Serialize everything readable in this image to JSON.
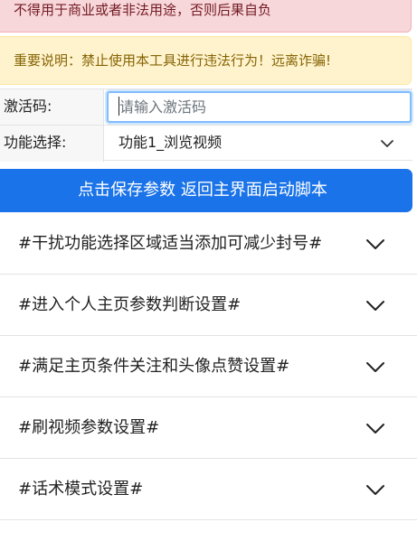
{
  "alerts": {
    "danger_text": "不得用于商业或者非法用途，否则后果自负",
    "warning_text": "重要说明：禁止使用本工具进行违法行为！远离诈骗!"
  },
  "form": {
    "activation": {
      "label": "激活码:",
      "placeholder": "请输入激活码",
      "value": ""
    },
    "function_select": {
      "label": "功能选择:",
      "selected": "功能1_浏览视频"
    }
  },
  "save_button": {
    "label": "点击保存参数 返回主界面启动脚本",
    "color": "#1a73e8"
  },
  "floating_icon": {
    "name": "briefcase-icon",
    "color": "#f39c12"
  },
  "accordion": {
    "items": [
      {
        "label": "#干扰功能选择区域适当添加可减少封号#"
      },
      {
        "label": "#进入个人主页参数判断设置#"
      },
      {
        "label": "#满足主页条件关注和头像点赞设置#"
      },
      {
        "label": "#刷视频参数设置#"
      },
      {
        "label": "#话术模式设置#"
      }
    ]
  }
}
